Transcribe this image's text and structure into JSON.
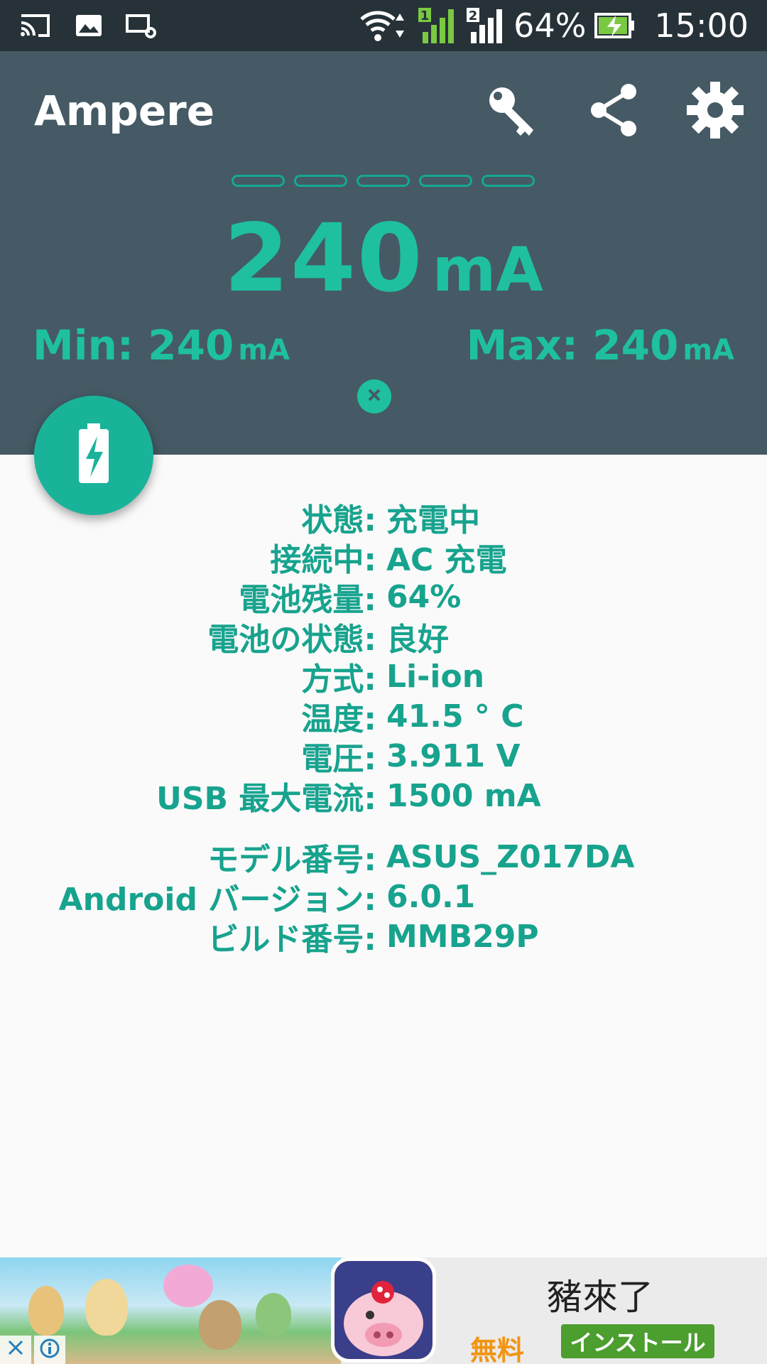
{
  "status_bar": {
    "battery_percent": "64%",
    "time": "15:00",
    "sim1_label": "1",
    "sim2_label": "2"
  },
  "header": {
    "app_title": "Ampere",
    "current_value": "240",
    "current_unit": "mA",
    "min_label": "Min:",
    "min_value": "240",
    "min_unit": "mA",
    "max_label": "Max:",
    "max_value": "240",
    "max_unit": "mA"
  },
  "info": {
    "rows": [
      {
        "label": "状態:",
        "value": "充電中"
      },
      {
        "label": "接続中:",
        "value": "AC 充電"
      },
      {
        "label": "電池残量:",
        "value": "64%"
      },
      {
        "label": "電池の状態:",
        "value": "良好"
      },
      {
        "label": "方式:",
        "value": "Li-ion"
      },
      {
        "label": "温度:",
        "value": "41.5 ° C"
      },
      {
        "label": "電圧:",
        "value": "3.911 V"
      },
      {
        "label": "USB 最大電流:",
        "value": "1500 mA"
      }
    ],
    "device_rows": [
      {
        "label": "モデル番号:",
        "value": "ASUS_Z017DA"
      },
      {
        "label": "Android バージョン:",
        "value": "6.0.1"
      },
      {
        "label": "ビルド番号:",
        "value": "MMB29P"
      }
    ]
  },
  "ad": {
    "app_name": "豬來了",
    "price": "無料",
    "install_label": "インストール"
  },
  "colors": {
    "accent": "#1ec0a0",
    "header_bg": "#455a64",
    "status_bg": "#263238"
  }
}
